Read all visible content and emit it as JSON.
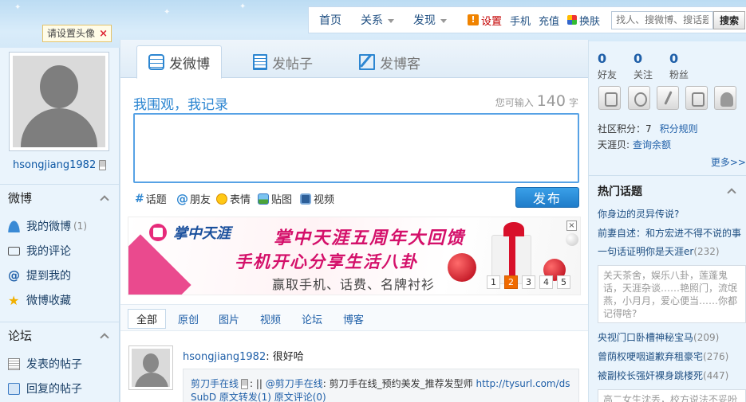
{
  "topnav": {
    "home": "首页",
    "relations": "关系",
    "discover": "发现",
    "settings": "设置",
    "mobile": "手机",
    "recharge": "充值",
    "skin": "换肤",
    "search_placeholder": "找人、搜微博、搜话题",
    "search_button": "搜索"
  },
  "avatar_tip": "请设置头像",
  "profile": {
    "username": "hsongjiang1982"
  },
  "left_sections": [
    {
      "title": "微博",
      "items": [
        {
          "label": "我的微博",
          "count": "(1)",
          "icon": "user-icon"
        },
        {
          "label": "我的评论",
          "count": "",
          "icon": "comment-icon"
        },
        {
          "label": "提到我的",
          "count": "",
          "icon": "at-icon"
        },
        {
          "label": "微博收藏",
          "count": "",
          "icon": "star-icon"
        }
      ]
    },
    {
      "title": "论坛",
      "items": [
        {
          "label": "发表的帖子",
          "icon": "document-icon"
        },
        {
          "label": "回复的帖子",
          "icon": "reply-icon"
        }
      ]
    }
  ],
  "post_tabs": [
    "发微博",
    "发帖子",
    "发博客"
  ],
  "composer": {
    "title": "我围观，我记录",
    "counter_prefix": "您可输入",
    "counter_value": "140",
    "counter_suffix": "字",
    "tools": [
      "话题",
      "朋友",
      "表情",
      "贴图",
      "视频"
    ],
    "publish": "发布"
  },
  "banner": {
    "brand": "掌中天涯",
    "title": "掌中天涯五周年大回馈",
    "subtitle": "手机开心分享生活八卦",
    "tagline": "赢取手机、话费、名牌衬衫",
    "close": "×",
    "pages": [
      "1",
      "2",
      "3",
      "4",
      "5"
    ],
    "active_page": "2"
  },
  "filter_tabs": [
    "全部",
    "原创",
    "图片",
    "视频",
    "论坛",
    "博客"
  ],
  "feed": {
    "author": "hsongjiang1982",
    "text": ": 很好哈",
    "repost_user": "剪刀手在线",
    "repost_mid": ": || ",
    "repost_at": "@剪刀手在线",
    "repost_text": ": 剪刀手在线_预约美发_推荐发型师 ",
    "repost_url": "http://tysurl.com/ds",
    "repost_line2": "SubD  原文转发(1)  原文评论(0)"
  },
  "stats": [
    {
      "value": "0",
      "label": "好友"
    },
    {
      "value": "0",
      "label": "关注"
    },
    {
      "value": "0",
      "label": "粉丝"
    }
  ],
  "score": {
    "label": "社区积分：7",
    "rules": "积分规则",
    "shell_label": "天涯贝:",
    "balance": "查询余额"
  },
  "more": "更多>>",
  "hot_topics": {
    "title": "热门话题",
    "items": [
      "你身边的灵异传说?",
      "前妻自述：和方宏进不得不说的事",
      "一句话证明你是天涯er"
    ],
    "item3_count": "(232)",
    "box1": "关天茶舍，娱乐八卦，莲蓬鬼话，天涯杂谈……艳照门，流氓燕，小月月，爱心便当……你都记得啥?",
    "list2": [
      {
        "text": "央视门口卧槽神秘宝马",
        "count": "(209)"
      },
      {
        "text": "曾荫权哽咽道歉弃租豪宅",
        "count": "(276)"
      },
      {
        "text": "被副校长强奸裸身跳楼死",
        "count": "(447)"
      }
    ],
    "box2": "高二女生沈丢，校方说法不妥吩"
  },
  "colors": {
    "accent": "#2d86d1",
    "link": "#1f5fa8",
    "banner_pink": "#d4106a",
    "pager_active": "#f06a00"
  }
}
